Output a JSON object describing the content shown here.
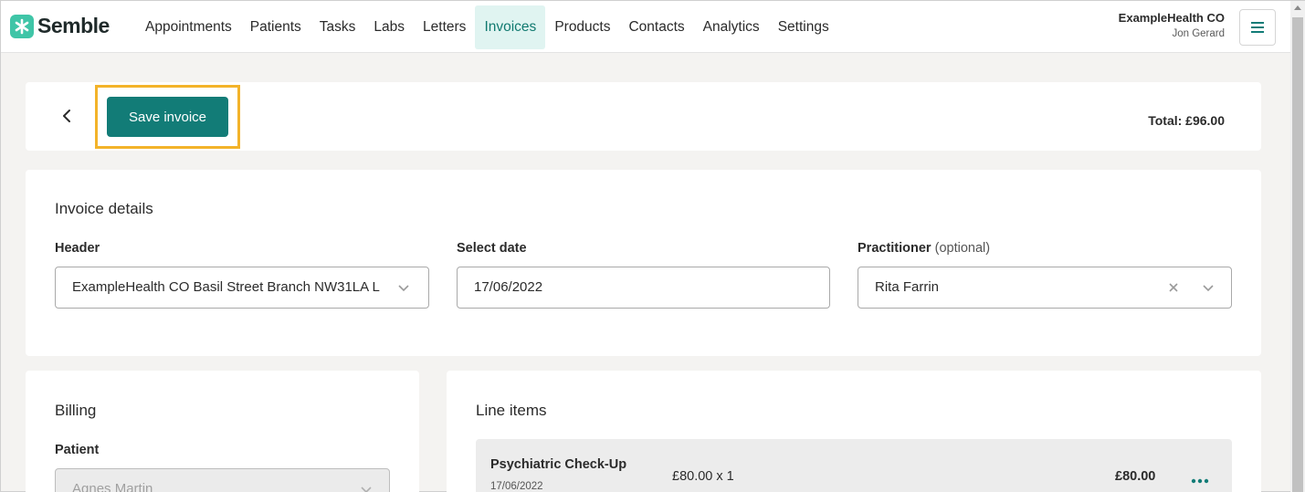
{
  "app": {
    "brand": "Semble",
    "brand_color": "#3fc5a7",
    "accent_color": "#127c77"
  },
  "nav": {
    "items": [
      {
        "label": "Appointments"
      },
      {
        "label": "Patients"
      },
      {
        "label": "Tasks"
      },
      {
        "label": "Labs"
      },
      {
        "label": "Letters"
      },
      {
        "label": "Invoices",
        "active": true
      },
      {
        "label": "Products"
      },
      {
        "label": "Contacts"
      },
      {
        "label": "Analytics"
      },
      {
        "label": "Settings"
      }
    ]
  },
  "account": {
    "org_name": "ExampleHealth CO",
    "user_name": "Jon Gerard",
    "menu_icon": "hamburger-icon"
  },
  "actionbar": {
    "back_icon": "chevron-left-icon",
    "save_label": "Save invoice",
    "total_label": "Total: £96.00",
    "highlight_color": "#f3b32a"
  },
  "invoice_details": {
    "title": "Invoice details",
    "header": {
      "label": "Header",
      "value": "ExampleHealth CO Basil Street Branch NW31LA L..."
    },
    "date": {
      "label": "Select date",
      "value": "17/06/2022"
    },
    "practitioner": {
      "label": "Practitioner",
      "optional_label": "(optional)",
      "value": "Rita Farrin"
    }
  },
  "billing": {
    "title": "Billing",
    "patient": {
      "label": "Patient",
      "value": "Agnes Martin"
    }
  },
  "line_items": {
    "title": "Line items",
    "items": [
      {
        "name": "Psychiatric Check-Up",
        "date": "17/06/2022",
        "qty": "£80.00 x 1",
        "amount": "£80.00"
      }
    ]
  }
}
